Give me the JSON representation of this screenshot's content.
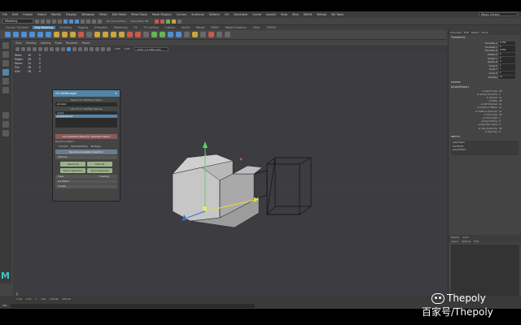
{
  "menubar": {
    "items": [
      "File",
      "Edit",
      "Create",
      "Select",
      "Modify",
      "Display",
      "Windows",
      "Mesh",
      "Edit Mesh",
      "Mesh Tools",
      "Mesh Display",
      "Curves",
      "Surfaces",
      "Deform",
      "UV",
      "Generate",
      "Cache",
      "Arnold",
      "Help",
      "Ziva",
      "MASH",
      "Bifrost",
      "3D Tools"
    ],
    "workspace_value": "Maya Classic"
  },
  "statusline": {
    "mode": "Modeling",
    "no_live_surface": "No Live Surface",
    "symmetry": "Symmetry: Off"
  },
  "shelf": {
    "tabs": [
      "Curves / Surfaces",
      "Poly Modeling",
      "Sculpting",
      "Rigging",
      "Animation",
      "Rendering",
      "FX",
      "FX Caching",
      "Custom",
      "Arnold",
      "Bifrost",
      "MASH",
      "Motion Graphics",
      "XGen",
      "TURTLE"
    ],
    "active_tab": "Poly Modeling"
  },
  "panel": {
    "menus": [
      "View",
      "Shading",
      "Lighting",
      "Show",
      "Renderer",
      "Panels"
    ],
    "camera_dropdown": "ACES 1.0 SDR-video",
    "exposure": "0.00",
    "gamma": "1.00"
  },
  "hud": {
    "rows": [
      {
        "k": "Verts:",
        "v": "16",
        "w": "0"
      },
      {
        "k": "Edges:",
        "v": "28",
        "w": "0"
      },
      {
        "k": "Faces:",
        "v": "14",
        "w": "0"
      },
      {
        "k": "Tris:",
        "v": "28",
        "w": "0"
      },
      {
        "k": "UVs:",
        "v": "18",
        "w": "0"
      }
    ],
    "camera_label": "persp"
  },
  "uv_window": {
    "title": "UV SetManager",
    "label_select": "Select UV Set/Map Object",
    "object_field": "pCube1",
    "label_list": "List Of UV Set/Map Names",
    "list_items": [
      "map1",
      "polySurface1"
    ],
    "btn_list": "List Available Maps for Selected Object",
    "label_rename": "Rename Object",
    "rename_radios": [
      "Current",
      "Selected/Map",
      "Multiple"
    ],
    "btn_rename": "Rename Available Selection",
    "section_options": "Options",
    "grid_buttons": [
      "Select All",
      "Hide All",
      "Select Selection",
      "Show Selected"
    ],
    "section_view": "View",
    "view_value": "Shading",
    "section_uv": "UV Editor",
    "section_create": "Create"
  },
  "channel_box": {
    "tabs": [
      "Channels",
      "Edit",
      "Object",
      "Show"
    ],
    "object_name": "Transform1",
    "attributes": [
      {
        "n": "Translate X",
        "v": "0.258"
      },
      {
        "n": "Translate Y",
        "v": "0"
      },
      {
        "n": "Translate Z",
        "v": "0.252"
      },
      {
        "n": "Rotate X",
        "v": "0"
      },
      {
        "n": "Rotate Y",
        "v": "0"
      },
      {
        "n": "Rotate Z",
        "v": "0"
      },
      {
        "n": "Scale X",
        "v": "1"
      },
      {
        "n": "Scale Y",
        "v": "1"
      },
      {
        "n": "Scale Z",
        "v": "1"
      },
      {
        "n": "Visibility",
        "v": "on"
      }
    ],
    "shapes_head": "SHAPES",
    "shape_name": "pCubeShape1",
    "shape_attrs": [
      {
        "n": "ai Subdiv Type",
        "v": "off"
      },
      {
        "n": "ai Subdiv Iterations",
        "v": "1"
      },
      {
        "n": "ai Opaque",
        "v": "on"
      },
      {
        "n": "ai Matte",
        "v": "off"
      },
      {
        "n": "ai Self Shadows",
        "v": "on"
      },
      {
        "n": "ai Visible In Diffuse",
        "v": "on"
      },
      {
        "n": "ai Visible In Specular",
        "v": "on"
      },
      {
        "n": "ai Trace Sets",
        "v": "off"
      },
      {
        "n": "ai Disp Height",
        "v": "1"
      },
      {
        "n": "ai Disp Padding",
        "v": "0"
      },
      {
        "n": "ai Disp Zero Value",
        "v": "0"
      },
      {
        "n": "ai Disp Autobump",
        "v": "off"
      },
      {
        "n": "ai Step Size",
        "v": "0"
      }
    ],
    "inputs_head": "INPUTS",
    "inputs": [
      "polyCube1",
      "OUTPUTS",
      "polyUVSet1"
    ]
  },
  "layer_editor": {
    "tabs": [
      "Display",
      "Anim"
    ],
    "menu": [
      "Layers",
      "Options",
      "Help"
    ]
  },
  "timeline": {
    "values": [
      "1.00",
      "1.00",
      "1",
      "120",
      "120.00",
      "200.00"
    ]
  },
  "cmdline": {
    "label": "MEL"
  },
  "watermark": {
    "line1": "Thepoly",
    "line2": "百家号/Thepoly"
  },
  "colors": {
    "accent": "#5285a6",
    "maya_logo": "#3cc7c0",
    "viewport_bg": "#3d3c41"
  }
}
